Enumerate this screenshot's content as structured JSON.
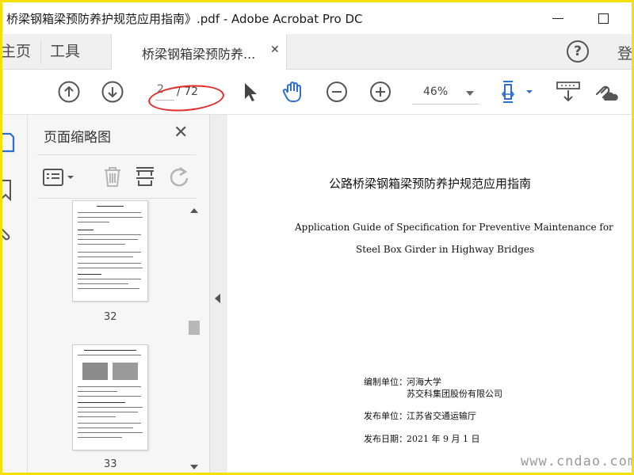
{
  "window": {
    "title": "桥梁钢箱梁预防养护规范应用指南》.pdf - Adobe Acrobat Pro DC"
  },
  "tabs": {
    "home_label": "主页",
    "tools_label": "工具",
    "doc_label": "桥梁钢箱梁预防养...",
    "signin_label": "登",
    "help_glyph": "?"
  },
  "toolbar": {
    "current_page": "2",
    "total_pages": "/ 72",
    "zoom": "46%",
    "annotation_color": "#e52a2a"
  },
  "panel": {
    "title": "页面缩略图",
    "thumbs": [
      {
        "label": "32"
      },
      {
        "label": "33"
      }
    ]
  },
  "document": {
    "cn_title": "公路桥梁钢箱梁预防养护规范应用指南",
    "en_title_line1": "Application Guide of Specification for Preventive Maintenance for",
    "en_title_line2": "Steel Box Girder in Highway Bridges",
    "compiler_label": "编制单位：",
    "compiler_1": "河海大学",
    "compiler_2": "苏交科集团股份有限公司",
    "publisher_label": "发布单位：",
    "publisher": "江苏省交通运输厅",
    "date_label": "发布日期：",
    "date": "2021 年 9 月 1 日"
  },
  "watermark": {
    "text": "www.cndao.com"
  },
  "colors": {
    "accent_blue": "#2f6fd3",
    "border_yellow": "#f5e000"
  }
}
